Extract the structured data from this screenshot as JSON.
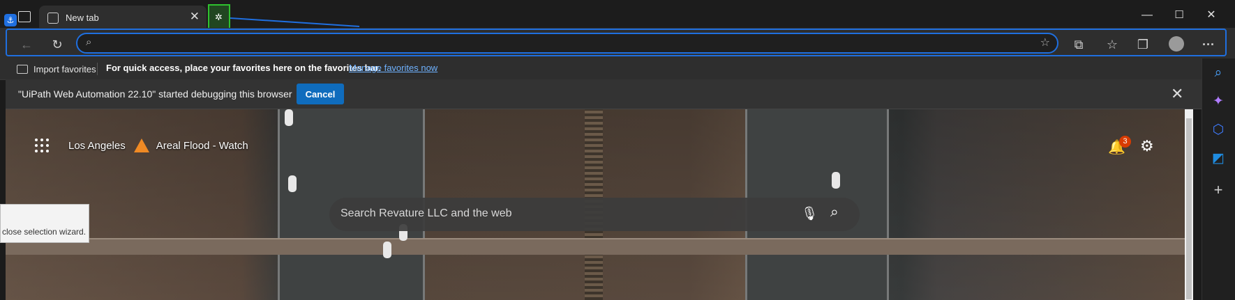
{
  "tab": {
    "title": "New tab",
    "close": "✕"
  },
  "window": {
    "minimize": "—",
    "maximize": "☐",
    "close": "✕"
  },
  "toolbar": {
    "address_value": "",
    "address_placeholder": ""
  },
  "favorites_bar": {
    "import_label": "Import favorites",
    "message": "For quick access, place your favorites here on the favorites bar.",
    "manage_link": "Manage favorites now"
  },
  "infobar": {
    "message": "\"UiPath Web Automation 22.10\" started debugging this browser",
    "cancel_label": "Cancel",
    "close": "✕"
  },
  "weather": {
    "location": "Los Angeles",
    "alert": "Areal Flood - Watch"
  },
  "search": {
    "placeholder": "Search Revature LLC and the web"
  },
  "notifications": {
    "count": "3"
  },
  "wizard": {
    "text": "close selection wizard."
  },
  "colors": {
    "accent": "#1f6fe0",
    "cancel_button": "#0f6cbd",
    "link": "#6fb2ff",
    "badge": "#d83b01",
    "selection_green": "#2fc22f"
  },
  "icons": {
    "back": "arrow-left-icon",
    "refresh": "refresh-icon",
    "search": "search-icon",
    "favorite_add": "star-plus-icon",
    "extensions": "puzzle-icon",
    "favorites": "star-list-icon",
    "collections": "collections-icon",
    "profile": "avatar-icon",
    "more": "ellipsis-icon",
    "mic": "microphone-icon",
    "bell": "bell-icon",
    "settings": "gear-icon"
  }
}
